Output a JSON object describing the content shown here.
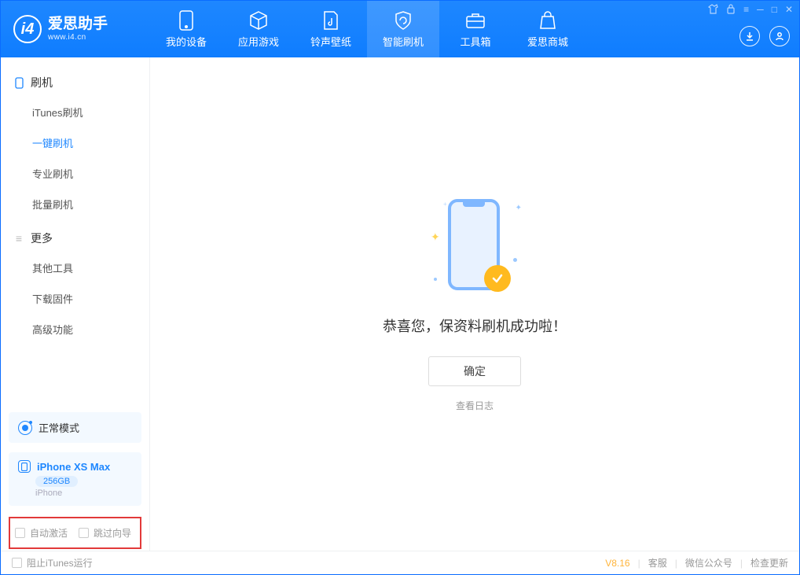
{
  "app": {
    "title": "爱思助手",
    "subtitle": "www.i4.cn"
  },
  "nav": {
    "device": "我的设备",
    "apps": "应用游戏",
    "ringtones": "铃声壁纸",
    "flash": "智能刷机",
    "toolbox": "工具箱",
    "store": "爱思商城"
  },
  "sidebar": {
    "section_flash": "刷机",
    "itunes_flash": "iTunes刷机",
    "one_click": "一键刷机",
    "pro_flash": "专业刷机",
    "batch_flash": "批量刷机",
    "section_more": "更多",
    "other_tools": "其他工具",
    "download_fw": "下载固件",
    "advanced": "高级功能"
  },
  "mode": {
    "label": "正常模式"
  },
  "device": {
    "name": "iPhone XS Max",
    "storage": "256GB",
    "type": "iPhone"
  },
  "checks": {
    "auto_activate": "自动激活",
    "skip_guide": "跳过向导"
  },
  "main": {
    "success": "恭喜您，保资料刷机成功啦！",
    "ok": "确定",
    "view_log": "查看日志"
  },
  "footer": {
    "block_itunes": "阻止iTunes运行",
    "version": "V8.16",
    "support": "客服",
    "wechat": "微信公众号",
    "update": "检查更新"
  }
}
